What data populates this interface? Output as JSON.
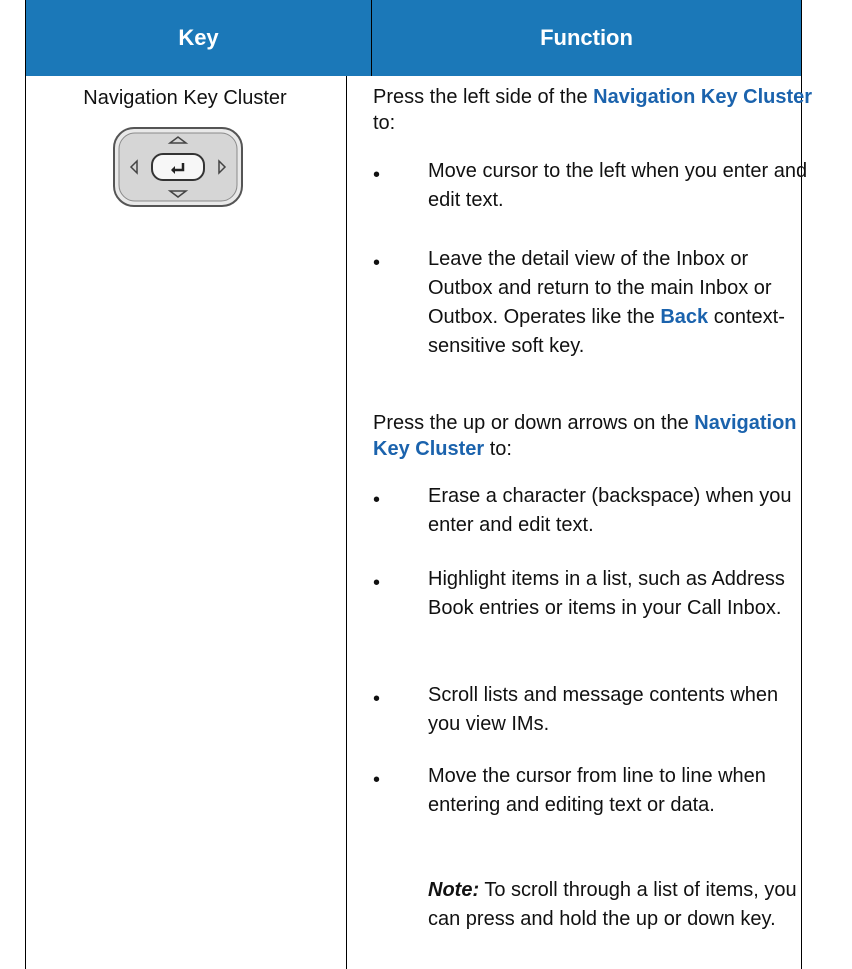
{
  "table": {
    "header": {
      "key": "Key",
      "function": "Function"
    },
    "key_name": "Navigation Key Cluster",
    "intro1": {
      "before": "Press the left side of the ",
      "keyword": "Navigation Key Cluster",
      "after": " to:"
    },
    "left_bullets": [
      "Move cursor to the left when you enter and edit text.",
      "Leave the detail view of the Inbox or Outbox and return to the main Inbox or Outbox. Operates like the"
    ],
    "left_bullet2_keyword": "Back",
    "left_bullet2_after": " context-sensitive soft key.",
    "intro2": {
      "before": "Press the up or down arrows on the ",
      "keyword": "Navigation Key Cluster",
      "after": " to:"
    },
    "updown_bullets": [
      "Erase a character (backspace) when you enter and edit text.",
      "Highlight items in a list, such as Address Book entries or items in your Call Inbox.",
      "Scroll lists and message contents when you view IMs.",
      "Move the cursor from line to line when entering and editing text or data."
    ],
    "bullet_symbol": "•",
    "note": {
      "label": "Note:",
      "text": "To scroll through a list of items, you can press and hold the up or down key."
    }
  }
}
